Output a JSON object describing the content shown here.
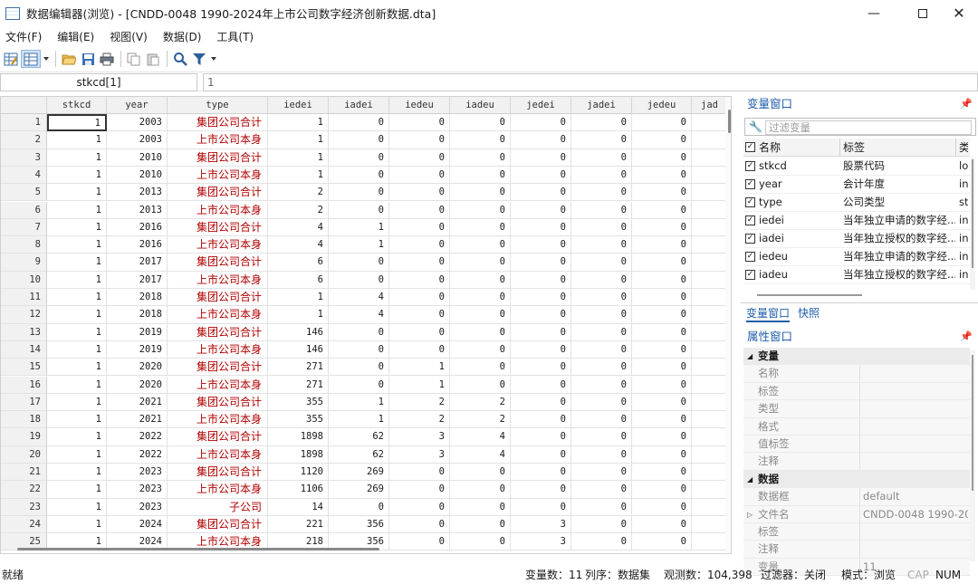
{
  "window": {
    "title": "数据编辑器(浏览) - [CNDD-0048 1990-2024年上市公司数字经济创新数据.dta]"
  },
  "menu": [
    "文件(F)",
    "编辑(E)",
    "视图(V)",
    "数据(D)",
    "工具(T)"
  ],
  "toolbar_icons": [
    "edit-mode-icon",
    "browse-mode-icon",
    "open-icon",
    "save-icon",
    "print-icon",
    "copy-icon",
    "paste-icon",
    "find-icon",
    "filter-icon"
  ],
  "formula": {
    "name": "stkcd[1]",
    "value": "1"
  },
  "grid": {
    "columns": [
      "stkcd",
      "year",
      "type",
      "iedei",
      "iadei",
      "iedeu",
      "iadeu",
      "jedei",
      "jadei",
      "jedeu",
      "jad"
    ],
    "rows": [
      [
        "1",
        "1",
        "2003",
        "集团公司合计",
        "1",
        "0",
        "0",
        "0",
        "0",
        "0",
        "0"
      ],
      [
        "2",
        "1",
        "2003",
        "上市公司本身",
        "1",
        "0",
        "0",
        "0",
        "0",
        "0",
        "0"
      ],
      [
        "3",
        "1",
        "2010",
        "集团公司合计",
        "1",
        "0",
        "0",
        "0",
        "0",
        "0",
        "0"
      ],
      [
        "4",
        "1",
        "2010",
        "上市公司本身",
        "1",
        "0",
        "0",
        "0",
        "0",
        "0",
        "0"
      ],
      [
        "5",
        "1",
        "2013",
        "集团公司合计",
        "2",
        "0",
        "0",
        "0",
        "0",
        "0",
        "0"
      ],
      [
        "6",
        "1",
        "2013",
        "上市公司本身",
        "2",
        "0",
        "0",
        "0",
        "0",
        "0",
        "0"
      ],
      [
        "7",
        "1",
        "2016",
        "集团公司合计",
        "4",
        "1",
        "0",
        "0",
        "0",
        "0",
        "0"
      ],
      [
        "8",
        "1",
        "2016",
        "上市公司本身",
        "4",
        "1",
        "0",
        "0",
        "0",
        "0",
        "0"
      ],
      [
        "9",
        "1",
        "2017",
        "集团公司合计",
        "6",
        "0",
        "0",
        "0",
        "0",
        "0",
        "0"
      ],
      [
        "10",
        "1",
        "2017",
        "上市公司本身",
        "6",
        "0",
        "0",
        "0",
        "0",
        "0",
        "0"
      ],
      [
        "11",
        "1",
        "2018",
        "集团公司合计",
        "1",
        "4",
        "0",
        "0",
        "0",
        "0",
        "0"
      ],
      [
        "12",
        "1",
        "2018",
        "上市公司本身",
        "1",
        "4",
        "0",
        "0",
        "0",
        "0",
        "0"
      ],
      [
        "13",
        "1",
        "2019",
        "集团公司合计",
        "146",
        "0",
        "0",
        "0",
        "0",
        "0",
        "0"
      ],
      [
        "14",
        "1",
        "2019",
        "上市公司本身",
        "146",
        "0",
        "0",
        "0",
        "0",
        "0",
        "0"
      ],
      [
        "15",
        "1",
        "2020",
        "集团公司合计",
        "271",
        "0",
        "1",
        "0",
        "0",
        "0",
        "0"
      ],
      [
        "16",
        "1",
        "2020",
        "上市公司本身",
        "271",
        "0",
        "1",
        "0",
        "0",
        "0",
        "0"
      ],
      [
        "17",
        "1",
        "2021",
        "集团公司合计",
        "355",
        "1",
        "2",
        "2",
        "0",
        "0",
        "0"
      ],
      [
        "18",
        "1",
        "2021",
        "上市公司本身",
        "355",
        "1",
        "2",
        "2",
        "0",
        "0",
        "0"
      ],
      [
        "19",
        "1",
        "2022",
        "集团公司合计",
        "1898",
        "62",
        "3",
        "4",
        "0",
        "0",
        "0"
      ],
      [
        "20",
        "1",
        "2022",
        "上市公司本身",
        "1898",
        "62",
        "3",
        "4",
        "0",
        "0",
        "0"
      ],
      [
        "21",
        "1",
        "2023",
        "集团公司合计",
        "1120",
        "269",
        "0",
        "0",
        "0",
        "0",
        "0"
      ],
      [
        "22",
        "1",
        "2023",
        "上市公司本身",
        "1106",
        "269",
        "0",
        "0",
        "0",
        "0",
        "0"
      ],
      [
        "23",
        "1",
        "2023",
        "子公司",
        "14",
        "0",
        "0",
        "0",
        "0",
        "0",
        "0"
      ],
      [
        "24",
        "1",
        "2024",
        "集团公司合计",
        "221",
        "356",
        "0",
        "0",
        "3",
        "0",
        "0"
      ],
      [
        "25",
        "1",
        "2024",
        "上市公司本身",
        "218",
        "356",
        "0",
        "0",
        "3",
        "0",
        "0"
      ]
    ]
  },
  "var_window": {
    "title": "变量窗口",
    "filter_placeholder": "过滤变量",
    "headers": {
      "name": "名称",
      "label": "标签",
      "type": "类"
    },
    "vars": [
      {
        "name": "stkcd",
        "label": "股票代码",
        "type": "lo"
      },
      {
        "name": "year",
        "label": "会计年度",
        "type": "in"
      },
      {
        "name": "type",
        "label": "公司类型",
        "type": "st"
      },
      {
        "name": "iedei",
        "label": "当年独立申请的数字经...",
        "type": "in"
      },
      {
        "name": "iadei",
        "label": "当年独立授权的数字经...",
        "type": "in"
      },
      {
        "name": "iedeu",
        "label": "当年独立申请的数字经...",
        "type": "in"
      },
      {
        "name": "iadeu",
        "label": "当年独立授权的数字经...",
        "type": "in"
      }
    ],
    "tabs": [
      "变量窗口",
      "快照"
    ]
  },
  "prop_window": {
    "title": "属性窗口",
    "groups": [
      {
        "name": "变量",
        "rows": [
          [
            "名称",
            ""
          ],
          [
            "标签",
            ""
          ],
          [
            "类型",
            ""
          ],
          [
            "格式",
            ""
          ],
          [
            "值标签",
            ""
          ],
          [
            "注释",
            ""
          ]
        ]
      },
      {
        "name": "数据",
        "rows": [
          [
            "数据框",
            "default"
          ],
          [
            "文件名",
            "CNDD-0048 1990-2024"
          ],
          [
            "标签",
            ""
          ],
          [
            "注释",
            ""
          ],
          [
            "变量",
            "11"
          ]
        ]
      }
    ]
  },
  "status": {
    "ready": "就绪",
    "varcount": "变量数：11",
    "order": "列序：数据集",
    "obs": "观测数：104,398",
    "filter": "过滤器：关闭",
    "mode": "模式：浏览",
    "cap": "CAP",
    "num": "NUM"
  },
  "colors": {
    "accent": "#1f5ea8",
    "string_cell": "#b00000"
  }
}
